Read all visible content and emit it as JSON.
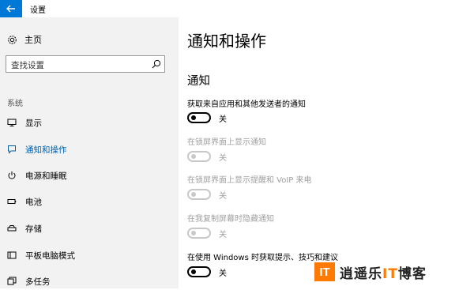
{
  "window": {
    "title": "设置",
    "back_icon": "arrow-left-icon",
    "accent": "#0078d7"
  },
  "sidebar": {
    "home_label": "主页",
    "search_placeholder": "查找设置",
    "section_label": "系统",
    "items": [
      {
        "label": "显示",
        "icon": "monitor-icon",
        "active": false
      },
      {
        "label": "通知和操作",
        "icon": "chat-bubble-icon",
        "active": true
      },
      {
        "label": "电源和睡眠",
        "icon": "power-icon",
        "active": false
      },
      {
        "label": "电池",
        "icon": "battery-icon",
        "active": false
      },
      {
        "label": "存储",
        "icon": "storage-icon",
        "active": false
      },
      {
        "label": "平板电脑模式",
        "icon": "tablet-icon",
        "active": false
      },
      {
        "label": "多任务",
        "icon": "multitask-icon",
        "active": false
      }
    ]
  },
  "main": {
    "page_title": "通知和操作",
    "section_title": "通知",
    "settings": [
      {
        "label": "获取来自应用和其他发送者的通知",
        "state": "关",
        "enabled": true
      },
      {
        "label": "在锁屏界面上显示通知",
        "state": "关",
        "enabled": false
      },
      {
        "label": "在锁屏界面上显示提醒和 VoIP 来电",
        "state": "关",
        "enabled": false
      },
      {
        "label": "在我复制屏幕时隐藏通知",
        "state": "关",
        "enabled": false
      },
      {
        "label": "在使用 Windows 时获取提示、技巧和建议",
        "state": "关",
        "enabled": true
      }
    ]
  },
  "watermark": {
    "box": "IT",
    "text_a": "逍遥乐",
    "text_it": "IT",
    "text_b": "博客",
    "color": "#ff7a00"
  }
}
